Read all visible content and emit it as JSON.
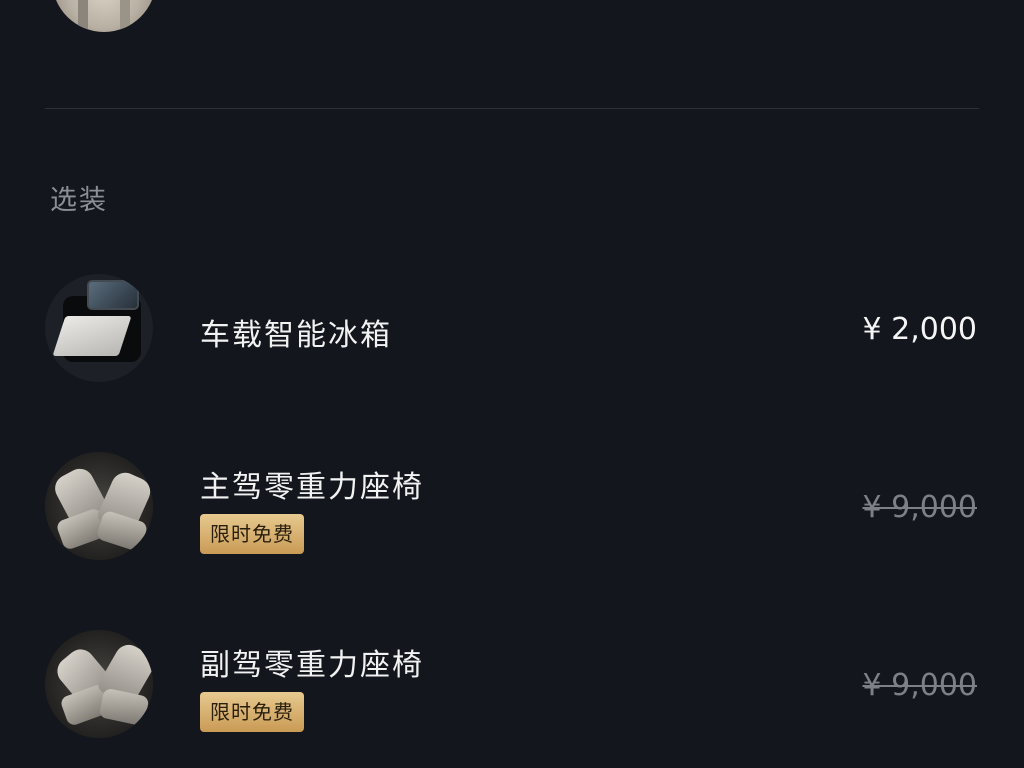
{
  "section": {
    "title": "选装"
  },
  "options": [
    {
      "name": "车载智能冰箱",
      "price": "¥ 2,000",
      "badge": "",
      "struck": false,
      "icon": "car-fridge-image"
    },
    {
      "name": "主驾零重力座椅",
      "price": "¥ 9,000",
      "badge": "限时免费",
      "struck": true,
      "icon": "driver-seat-image"
    },
    {
      "name": "副驾零重力座椅",
      "price": "¥ 9,000",
      "badge": "限时免费",
      "struck": true,
      "icon": "passenger-seat-image"
    }
  ],
  "colors": {
    "background": "#13161c",
    "badge_gold": "#d9b373",
    "struck_price": "#7d8087",
    "section_title": "#8b8e95"
  }
}
